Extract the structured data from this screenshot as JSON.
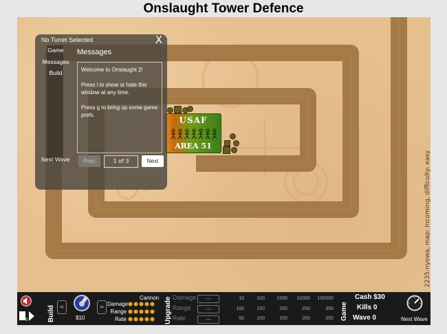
{
  "title": "Onslaught Tower Defence",
  "side_info": "2235-nyowa, map: Incoming, difficulty: easy",
  "panel": {
    "header": "No Turret Selected",
    "close": "X",
    "tabs": [
      "Game",
      "Messages",
      "Build"
    ],
    "messages_title": "Messages",
    "messages": [
      "Welcome to Onslaught 2!",
      "Press i to show or hide this window at any time.",
      "Press g to bring up some game prefs."
    ],
    "next_wave_label": "Next Wave",
    "prev_label": "Prev",
    "page_indicator": "1 of 3",
    "next_label": "Next"
  },
  "base": {
    "top": "USAF",
    "bottom": "AREA 51"
  },
  "toolbar": {
    "build_label": "Build",
    "build_arrow_left": "<",
    "build_arrow_right": ">",
    "turret_price": "$10",
    "turret_name": "Cannon",
    "stats": [
      {
        "label": "Damage",
        "level": 2
      },
      {
        "label": "Range",
        "level": 2
      },
      {
        "label": "Rate",
        "level": 2
      }
    ],
    "upgrade_label": "Upgrade",
    "upgrade_rows": [
      {
        "label": "Damage",
        "box": "---",
        "values": [
          "10",
          "100",
          "1000",
          "10000",
          "100000"
        ]
      },
      {
        "label": "Range",
        "box": "---",
        "values": [
          "100",
          "150",
          "200",
          "250",
          "350"
        ]
      },
      {
        "label": "Rate",
        "box": "---",
        "values": [
          "50",
          "100",
          "150",
          "200",
          "250"
        ]
      }
    ],
    "game_label": "Game",
    "cash_label": "Cash",
    "cash_value": "$30",
    "kills_label": "Kills",
    "kills_value": "0",
    "wave_label": "Wave",
    "wave_value": "0",
    "next_wave_label": "Next Wave"
  },
  "colors": {
    "terrain": "#e6bf8f",
    "path": "#a57a46",
    "panel": "#4b463e",
    "bar": "#1a1a1a",
    "accent": "#e9a93c"
  }
}
